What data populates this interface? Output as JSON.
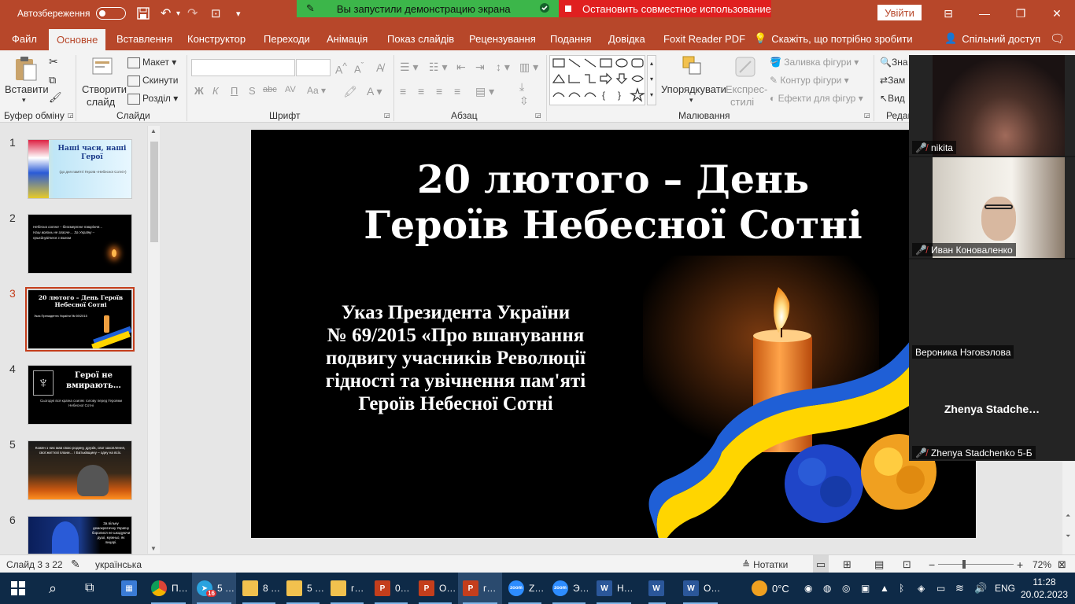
{
  "titlebar": {
    "autosave_label": "Автозбереження",
    "share_banner": "Вы запустили демонстрацию экрана",
    "stop_share": "Остановить совместное использование",
    "login": "Увійти"
  },
  "tabs": [
    "Файл",
    "Основне",
    "Вставлення",
    "Конструктор",
    "Переходи",
    "Анімація",
    "Показ слайдів",
    "Рецензування",
    "Подання",
    "Довідка",
    "Foxit Reader PDF"
  ],
  "tab_active": "Основне",
  "tell_me": "Скажіть, що потрібно зробити",
  "share_button": "Спільний доступ",
  "ribbon": {
    "paste": "Вставити",
    "clipboard_group": "Буфер обміну",
    "new_slide_1": "Створити",
    "new_slide_2": "слайд",
    "layout": "Макет",
    "reset": "Скинути",
    "section": "Розділ",
    "slides_group": "Слайди",
    "font_group": "Шрифт",
    "paragraph_group": "Абзац",
    "arrange": "Упорядкувати",
    "quick_styles_1": "Експрес-",
    "quick_styles_2": "стилі",
    "shape_fill": "Заливка фігури",
    "shape_outline": "Контур фігури",
    "shape_effects": "Ефекти для фігур",
    "drawing_group": "Малювання",
    "find": "Зна",
    "replace": "Зам",
    "select": "Вид",
    "editing_group": "Редаг"
  },
  "slides": [
    {
      "num": "1",
      "title": "Наші часи, наші Герої",
      "subtitle": "(до дня пам'яті Героїв «Небесної Сотні»)"
    },
    {
      "num": "2",
      "text": "Небесна сотня – безсмертне творіння… Наш вогонь не згасне… За Україну – приєднуйтеся з Богом"
    },
    {
      "num": "3",
      "title": "20 лютого – День Героїв Небесної Сотні",
      "text": "Указ Президента України № 69/2015"
    },
    {
      "num": "4",
      "title": "Герої не вмирають…",
      "text": "Сьогодні вся країна схиляє голову перед Героями Небесної Сотні"
    },
    {
      "num": "5",
      "text": "Кожен з них мав свою родину, друзів, свої захоплення, свої життєві плани… І Батьківщину – одну на всіх."
    },
    {
      "num": "6",
      "text": "За вільну демократичну Україну боролися не шкодуючи душі, мужньо, як лицарі."
    }
  ],
  "active_slide": "3",
  "current_slide": {
    "title_line1": "20 лютого – День",
    "title_line2": "Героїв Небесної Сотні",
    "body": [
      "Указ Президента України",
      "№ 69/2015 «Про вшанування",
      "подвигу учасників Революції",
      "гідності та увічнення пам'яті",
      "Героїв Небесної Сотні"
    ]
  },
  "participants": [
    {
      "name": "nikita",
      "muted": true,
      "video": true
    },
    {
      "name": "Иван Коноваленко",
      "muted": true,
      "video": true
    },
    {
      "name": "Вероника Нэговэлова",
      "muted": false,
      "video": false
    },
    {
      "name": "Zhenya Stadchenko 5-Б",
      "display": "Zhenya  Stadche…",
      "muted": true,
      "video": false
    }
  ],
  "status": {
    "slide_info": "Слайд 3 з 22",
    "language": "українська",
    "notes": "Нотатки",
    "zoom": "72%"
  },
  "taskbar": {
    "apps": [
      {
        "label": "П…",
        "icon": "chrome-icon",
        "color": "#e8e8e8"
      },
      {
        "label": "5 …",
        "icon": "telegram-icon",
        "color": "#2aa3df",
        "badge": "16"
      },
      {
        "label": "8 …",
        "icon": "folder-icon",
        "color": "#f2c14e"
      },
      {
        "label": "5 …",
        "icon": "folder-icon",
        "color": "#f2c14e"
      },
      {
        "label": "г…",
        "icon": "folder-icon",
        "color": "#f2c14e"
      },
      {
        "label": "0…",
        "icon": "powerpoint-icon",
        "color": "#c43e1c"
      },
      {
        "label": "О…",
        "icon": "powerpoint-icon",
        "color": "#c43e1c"
      },
      {
        "label": "г…",
        "icon": "powerpoint-icon",
        "color": "#c43e1c"
      },
      {
        "label": "Z…",
        "icon": "zoom-icon",
        "color": "#2d8cff"
      },
      {
        "label": "Э…",
        "icon": "zoom-icon",
        "color": "#2d8cff"
      },
      {
        "label": "Н…",
        "icon": "word-icon",
        "color": "#2b579a"
      },
      {
        "label": "",
        "icon": "word-icon",
        "color": "#2b579a"
      },
      {
        "label": "О…",
        "icon": "word-icon",
        "color": "#2b579a"
      }
    ],
    "weather": "0°C",
    "lang": "ENG",
    "time": "11:28",
    "date": "20.02.2023"
  }
}
